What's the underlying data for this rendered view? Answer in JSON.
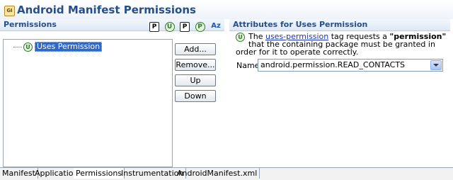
{
  "window": {
    "title": "Android Manifest Permissions"
  },
  "left_panel": {
    "header": "Permissions",
    "toolbar_icons": [
      "P",
      "U",
      "P",
      "P",
      "Az"
    ],
    "tree": [
      {
        "label": "Uses Permission",
        "icon": "uses-permission-icon"
      }
    ],
    "buttons": {
      "add": "Add...",
      "remove": "Remove...",
      "up": "Up",
      "down": "Down"
    }
  },
  "right_panel": {
    "header": "Attributes for Uses Permission",
    "desc_pre": "The ",
    "desc_link": "uses-permission",
    "desc_mid": " tag requests a ",
    "desc_bold": "\"permission\"",
    "desc_post": " that the containing package must be granted in order for it to operate correctly.",
    "name_label": "Name",
    "name_value": "android.permission.READ_CONTACTS"
  },
  "tabs": [
    "Manifest",
    "Application",
    "Permissions",
    "Instrumentation",
    "AndroidManifest.xml"
  ],
  "active_tab": "Permissions"
}
